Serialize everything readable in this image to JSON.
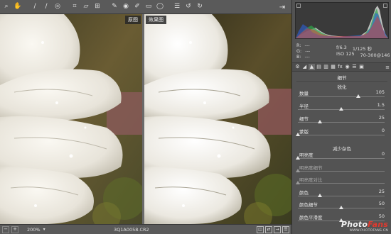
{
  "toolbar": {
    "tools": [
      {
        "icon": "zoom-tool-icon",
        "glyph": "🔍"
      },
      {
        "icon": "hand-tool-icon",
        "glyph": "✋"
      },
      {
        "icon": "white-balance-tool-icon",
        "glyph": "⁄"
      },
      {
        "icon": "color-sampler-tool-icon",
        "glyph": "⁄"
      },
      {
        "icon": "targeted-adjustment-tool-icon",
        "glyph": "◎"
      },
      {
        "icon": "crop-tool-icon",
        "glyph": "⌗"
      },
      {
        "icon": "straighten-tool-icon",
        "glyph": "▱"
      },
      {
        "icon": "transform-tool-icon",
        "glyph": "⊞"
      },
      {
        "icon": "spot-removal-tool-icon",
        "glyph": "✎"
      },
      {
        "icon": "red-eye-tool-icon",
        "glyph": "◉"
      },
      {
        "icon": "adjustment-brush-icon",
        "glyph": "✐"
      },
      {
        "icon": "graduated-filter-icon",
        "glyph": "▭"
      },
      {
        "icon": "radial-filter-icon",
        "glyph": "◯"
      },
      {
        "icon": "preferences-icon",
        "glyph": "☰"
      },
      {
        "icon": "rotate-left-icon",
        "glyph": "↺"
      },
      {
        "icon": "rotate-right-icon",
        "glyph": "↻"
      }
    ],
    "export_icon": "export-icon"
  },
  "preview": {
    "before_label": "原图",
    "after_label": "效果图"
  },
  "status": {
    "zoom": "200%",
    "filename": "3Q1A0058.CR2"
  },
  "info": {
    "rgb": [
      {
        "label": "R:",
        "value": "---"
      },
      {
        "label": "G:",
        "value": "---"
      },
      {
        "label": "B:",
        "value": "---"
      }
    ],
    "exif": {
      "aperture": "f/6.3",
      "shutter": "1/125 秒",
      "iso": "ISO 125",
      "lens": "70-300@146 毫米"
    }
  },
  "panel": {
    "title": "细节",
    "sharpening_title": "锐化",
    "noise_title": "减少杂色",
    "sharpening": [
      {
        "label": "数量",
        "value": "105",
        "pos": 0.7,
        "dim": false
      },
      {
        "label": "半径",
        "value": "1.5",
        "pos": 0.5,
        "dim": false
      },
      {
        "label": "细节",
        "value": "25",
        "pos": 0.25,
        "dim": false
      },
      {
        "label": "蒙版",
        "value": "0",
        "pos": 0.0,
        "dim": false
      }
    ],
    "noise": [
      {
        "label": "明亮度",
        "value": "0",
        "pos": 0.0,
        "dim": false
      },
      {
        "label": "明亮度细节",
        "value": "",
        "pos": 0.0,
        "dim": true
      },
      {
        "label": "明亮度对比",
        "value": "",
        "pos": 0.0,
        "dim": true
      },
      {
        "label": "颜色",
        "value": "25",
        "pos": 0.25,
        "dim": false
      },
      {
        "label": "颜色细节",
        "value": "50",
        "pos": 0.5,
        "dim": false
      },
      {
        "label": "颜色平滑度",
        "value": "50",
        "pos": 0.5,
        "dim": false
      }
    ]
  },
  "watermark": {
    "logo_a": "Photo",
    "logo_b": "Fans",
    "url": "WWW.PHOTOFANS.CN"
  }
}
